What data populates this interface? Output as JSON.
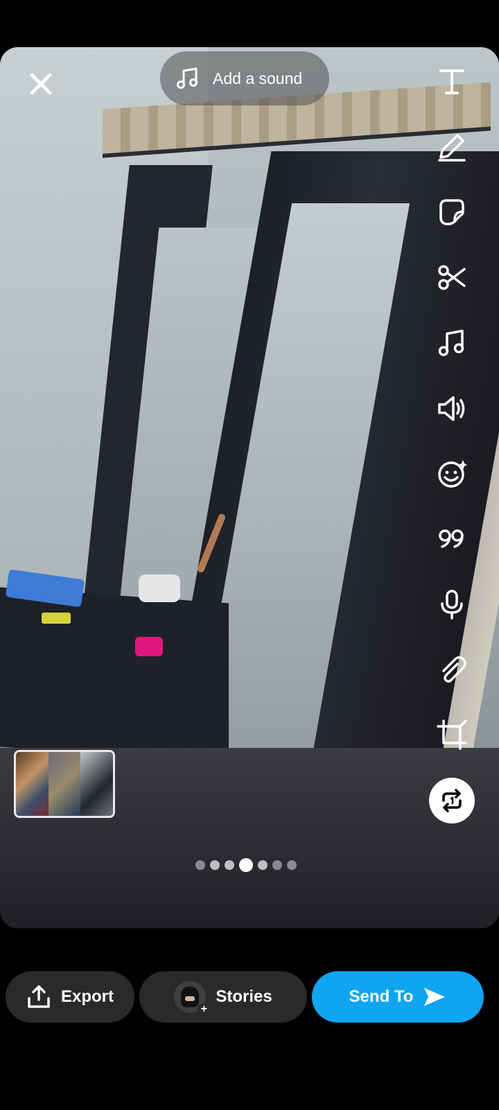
{
  "top": {
    "close_icon": "close-icon",
    "sound_label": "Add a sound",
    "sound_icon": "music-note-icon"
  },
  "toolbar": {
    "items": [
      {
        "name": "text-tool",
        "icon": "text-icon"
      },
      {
        "name": "draw-tool",
        "icon": "pencil-icon"
      },
      {
        "name": "sticker-tool",
        "icon": "sticker-icon"
      },
      {
        "name": "scissors-tool",
        "icon": "scissors-icon"
      },
      {
        "name": "music-tool",
        "icon": "music-note-icon"
      },
      {
        "name": "volume-tool",
        "icon": "volume-icon"
      },
      {
        "name": "lens-tool",
        "icon": "smiley-sparkle-icon"
      },
      {
        "name": "quote-tool",
        "icon": "quote-icon"
      },
      {
        "name": "voice-tool",
        "icon": "microphone-icon"
      },
      {
        "name": "attachment-tool",
        "icon": "paperclip-icon"
      },
      {
        "name": "crop-tool",
        "icon": "crop-icon"
      },
      {
        "name": "loop-tool",
        "icon": "loop-icon"
      }
    ]
  },
  "carousel": {
    "total_dots": 7,
    "active_index": 3
  },
  "bottom": {
    "export_label": "Export",
    "stories_label": "Stories",
    "send_label": "Send To"
  },
  "colors": {
    "send_button": "#0fa5f2",
    "pill_background": "#2a2a2a"
  }
}
